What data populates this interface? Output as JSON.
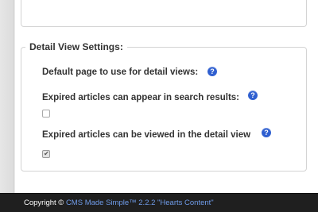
{
  "settings": {
    "legend": "Detail View Settings:",
    "fields": [
      {
        "label": "Default page to use for detail views:",
        "help_icon": "question-mark-icon"
      },
      {
        "label": "Expired articles can appear in search results:",
        "help_icon": "question-mark-icon",
        "checked": false
      },
      {
        "label": "Expired articles can be viewed in the detail view",
        "help_icon": "question-mark-icon",
        "checked": true
      }
    ],
    "help_glyph": "?"
  },
  "footer": {
    "copyright": "Copyright © ",
    "link_text": "CMS Made Simple™ 2.2.2 \"Hearts Content\""
  },
  "colors": {
    "help_icon": "#2f5fd0",
    "footer_bg": "#1f1f1f",
    "footer_link": "#6f9be8"
  }
}
